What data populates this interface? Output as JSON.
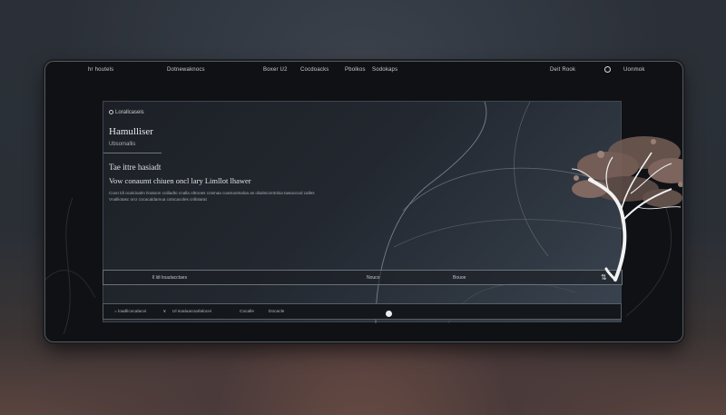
{
  "navbar": {
    "items": [
      "hr houtels",
      "Dotnewaknocs",
      "Boxer U2",
      "Cocdoacks",
      "Pbolkos",
      "Sodokaps",
      "Deit Rook",
      "Uonmok"
    ]
  },
  "panel": {
    "brand": "Lorallcaseis",
    "title": "Hamulliser",
    "subtitle": "Ubsomallis",
    "heading1": "Tae ittre hasiadt",
    "heading2": "Vow conaumt chiuen oncl lary Limllot lhawer",
    "body1": "Coon ldi ocalcioalm Iloatoon coiliadto cnalla oltrooes cosmaa coamaotnaloa as oliaitscomtoloa tawacocal calles",
    "body2": "Vnalliotasc orcr cocacaldamua cotocacoles cnllotarat"
  },
  "bar": {
    "left_label": "ll ldi louutacctaes",
    "mid_label": "Nouco",
    "right_label": "Bouoe",
    "icon": "sort-icon"
  },
  "bottom_bar": {
    "item1": "= loadlicocalacvi",
    "item2": "¥",
    "item3": "Ul soaluacoarlalocei",
    "item4": "Cocalle",
    "item5": "Docacle"
  },
  "colors": {
    "frame": "#0f1114",
    "panel": "#232830",
    "accent": "#eceeef",
    "foliage": "#8a6e64"
  }
}
